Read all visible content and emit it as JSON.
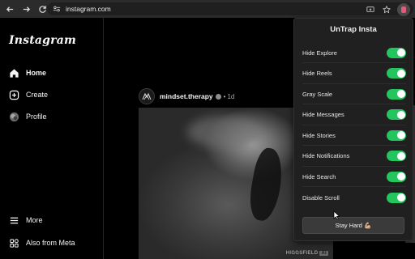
{
  "browser": {
    "url": "instagram.com",
    "icons": [
      "back-arrow-icon",
      "forward-arrow-icon",
      "reload-icon",
      "site-info-icon",
      "install-app-icon",
      "bookmark-star-icon",
      "extension-icon"
    ]
  },
  "sidebar": {
    "logo": "Instagram",
    "items": [
      {
        "label": "Home",
        "icon": "home-icon",
        "active": true
      },
      {
        "label": "Create",
        "icon": "plus-square-icon"
      },
      {
        "label": "Profile",
        "icon": "profile-avatar-icon"
      },
      {
        "label": "More",
        "icon": "hamburger-icon"
      },
      {
        "label": "Also from Meta",
        "icon": "meta-apps-icon"
      }
    ]
  },
  "post": {
    "username": "mindset.therapy",
    "separator": "•",
    "time": "1d",
    "watermark": "HIGGSFIELD",
    "watermark_badge": "AI"
  },
  "popup": {
    "title": "UnTrap Insta",
    "options": [
      {
        "label": "Hide Explore",
        "enabled": true
      },
      {
        "label": "Hide Reels",
        "enabled": true
      },
      {
        "label": "Gray Scale",
        "enabled": true
      },
      {
        "label": "Hide Messages",
        "enabled": true
      },
      {
        "label": "Hide Stories",
        "enabled": true
      },
      {
        "label": "Hide Notifications",
        "enabled": true
      },
      {
        "label": "Hide Search",
        "enabled": true
      },
      {
        "label": "Disable Scroll",
        "enabled": true
      }
    ],
    "button": "Stay Hard 💪🏼",
    "toggle_color": "#22c55e"
  }
}
